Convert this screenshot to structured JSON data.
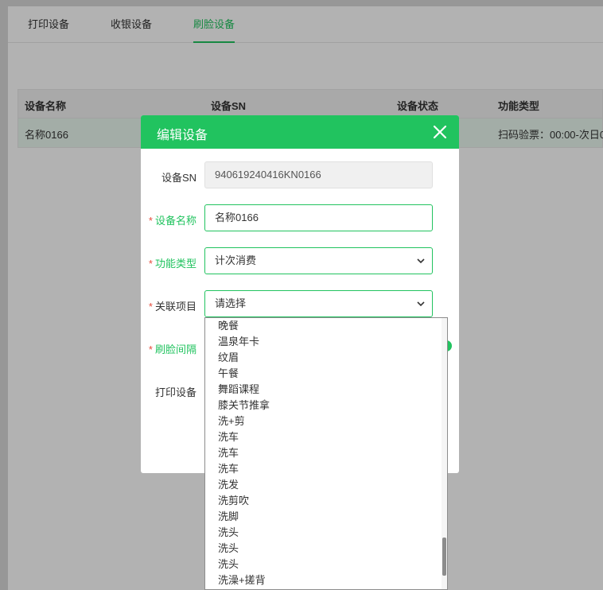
{
  "tabs": [
    {
      "label": "打印设备",
      "active": false
    },
    {
      "label": "收银设备",
      "active": false
    },
    {
      "label": "刷脸设备",
      "active": true
    }
  ],
  "table": {
    "headers": [
      "设备名称",
      "设备SN",
      "设备状态",
      "功能类型"
    ],
    "rows": [
      {
        "name": "名称0166",
        "func": "扫码验票：00:00-次日0"
      }
    ]
  },
  "dialog": {
    "title": "编辑设备",
    "fields": {
      "sn": {
        "label": "设备SN",
        "value": "940619240416KN0166"
      },
      "name": {
        "label": "设备名称",
        "value": "名称0166"
      },
      "func_type": {
        "label": "功能类型",
        "value": "计次消费"
      },
      "project": {
        "label": "关联项目",
        "value": "请选择"
      },
      "interval": {
        "label": "刷脸间隔"
      },
      "printer": {
        "label": "打印设备"
      }
    },
    "required_mark": "*"
  },
  "dropdown": {
    "options": [
      "晚餐",
      "温泉年卡",
      "纹眉",
      "午餐",
      "舞蹈课程",
      "膝关节推拿",
      "洗+剪",
      "洗车",
      "洗车",
      "洗车",
      "洗发",
      "洗剪吹",
      "洗脚",
      "洗头",
      "洗头",
      "洗头",
      "洗澡+搓背"
    ]
  },
  "colors": {
    "accent": "#21c35f",
    "required": "#e74c3c"
  },
  "icons": {
    "close": "close-icon",
    "chevron": "chevron-down-icon"
  }
}
